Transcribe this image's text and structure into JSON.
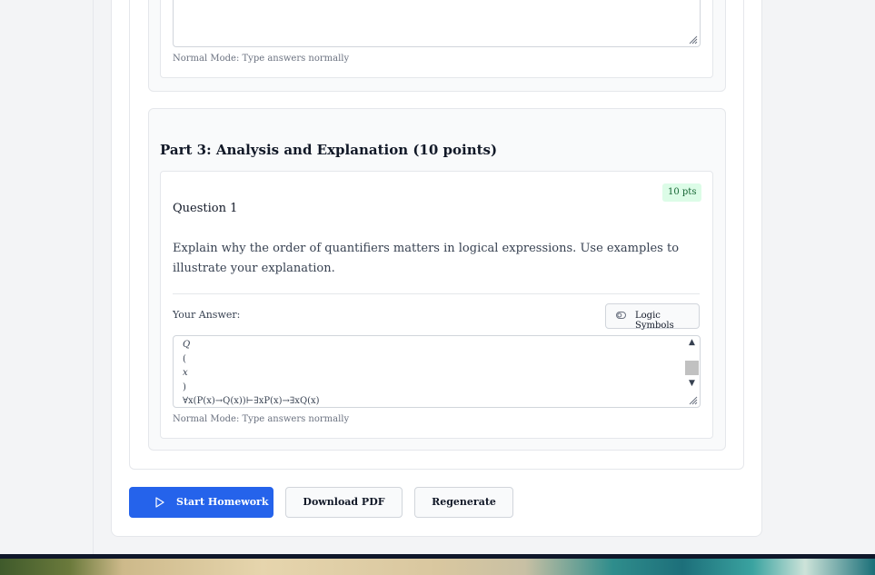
{
  "previous_question": {
    "mode_hint": "Normal Mode: Type answers normally"
  },
  "section": {
    "title": "Part 3: Analysis and Explanation (10 points)"
  },
  "question": {
    "number": "Question 1",
    "points": "10 pts",
    "text": "Explain why the order of quantifiers matters in logical expressions. Use examples to illustrate your explanation.",
    "answer_label": "Your Answer:",
    "logic_button": "Logic Symbols",
    "answer_lines": [
      "Q",
      "(",
      "x",
      ")",
      "∀x(P(x)→Q(x))⊢∃xP(x)→∃xQ(x)"
    ],
    "mode_hint": "Normal Mode: Type answers normally"
  },
  "actions": {
    "start": "Start Homework",
    "download": "Download PDF",
    "regenerate": "Regenerate"
  },
  "colors": {
    "primary": "#2563eb",
    "badge_bg": "#dcfce7",
    "badge_text": "#166534"
  }
}
